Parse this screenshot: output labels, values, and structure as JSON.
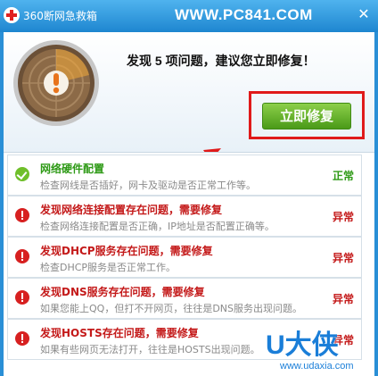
{
  "window": {
    "title": "360断网急救箱",
    "watermark": "WWW.PC841.COM",
    "close_glyph": "✕"
  },
  "header": {
    "headline": "发现 5 项问题，建议您立即修复！",
    "fix_button_label": "立即修复",
    "gauge_icon": "warning-exclamation-icon"
  },
  "items": [
    {
      "title": "网络硬件配置",
      "desc": "检查网线是否插好，网卡及驱动是否正常工作等。",
      "status": "正常",
      "state": "ok"
    },
    {
      "title": "发现网络连接配置存在问题，需要修复",
      "desc": "检查网络连接配置是否正确，IP地址是否配置正确等。",
      "status": "异常",
      "state": "error"
    },
    {
      "title": "发现DHCP服务存在问题，需要修复",
      "desc": "检查DHCP服务是否正常工作。",
      "status": "异常",
      "state": "error"
    },
    {
      "title": "发现DNS服务存在问题，需要修复",
      "desc": "如果您能上QQ，但打不开网页，往往是DNS服务出现问题。",
      "status": "异常",
      "state": "error"
    },
    {
      "title": "发现HOSTS存在问题，需要修复",
      "desc": "如果有些网页无法打开，往往是HOSTS出现问题。",
      "status": "异常",
      "state": "error"
    }
  ],
  "brand": {
    "main": "U大侠",
    "url": "www.udaxia.com"
  },
  "colors": {
    "accent": "#1e86d0",
    "ok": "#2e9a16",
    "error": "#c41a1a",
    "highlight_box": "#e01a1a",
    "button": "#5aa822"
  }
}
